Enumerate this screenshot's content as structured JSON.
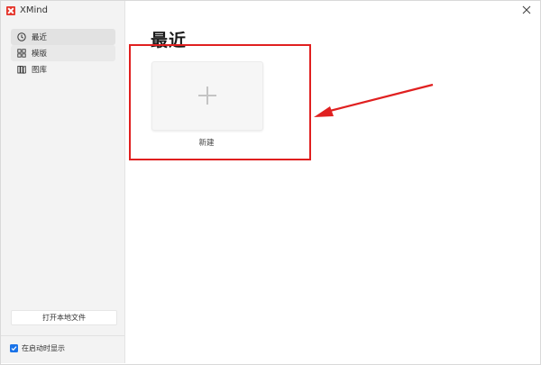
{
  "app": {
    "title": "XMind"
  },
  "sidebar": {
    "items": [
      {
        "label": "最近",
        "icon": "clock-icon",
        "active": true
      },
      {
        "label": "模版",
        "icon": "grid-icon",
        "active": false
      },
      {
        "label": "图库",
        "icon": "library-icon",
        "active": false
      }
    ],
    "open_local_label": "打开本地文件",
    "show_on_startup_label": "在启动时显示",
    "show_on_startup_checked": true
  },
  "main": {
    "title": "最近",
    "new_card_label": "新建"
  },
  "colors": {
    "accent": "#1a73e8",
    "brand": "#e5382e",
    "annotation": "#e02020"
  }
}
